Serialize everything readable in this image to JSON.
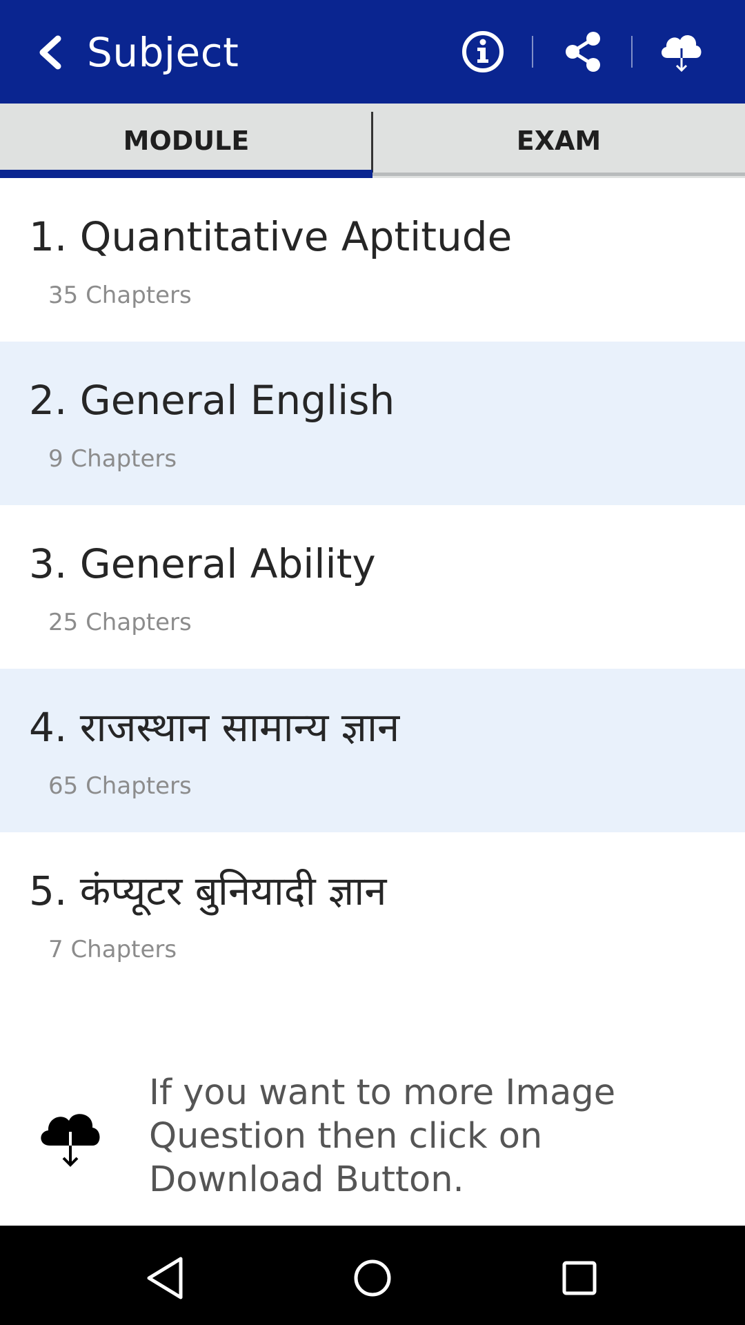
{
  "appbar": {
    "title": "Subject",
    "icons": [
      "back-icon",
      "info-icon",
      "share-icon",
      "cloud-download-icon"
    ],
    "background": "#0a2590"
  },
  "tabs": [
    {
      "label": "MODULE",
      "selected": true
    },
    {
      "label": "EXAM",
      "selected": false
    }
  ],
  "modules": [
    {
      "title": "1. Quantitative Aptitude",
      "chapters": "35 Chapters"
    },
    {
      "title": "2. General English",
      "chapters": "9 Chapters"
    },
    {
      "title": "3. General Ability",
      "chapters": "25 Chapters"
    },
    {
      "title": "4. राजस्थान सामान्य ज्ञान",
      "chapters": "65 Chapters"
    },
    {
      "title": "5. कंप्यूटर बुनियादी ज्ञान",
      "chapters": "7 Chapters"
    }
  ],
  "banner": {
    "icon": "cloud-download-icon",
    "text": "If you want to more Image Question then click on Download Button."
  },
  "navbar": {
    "icons": [
      "nav-back-icon",
      "nav-home-icon",
      "nav-recents-icon"
    ]
  },
  "colors": {
    "accent": "#0a2590",
    "alt_row": "#e9f1fb",
    "tab_bg": "#dfe1e0"
  }
}
